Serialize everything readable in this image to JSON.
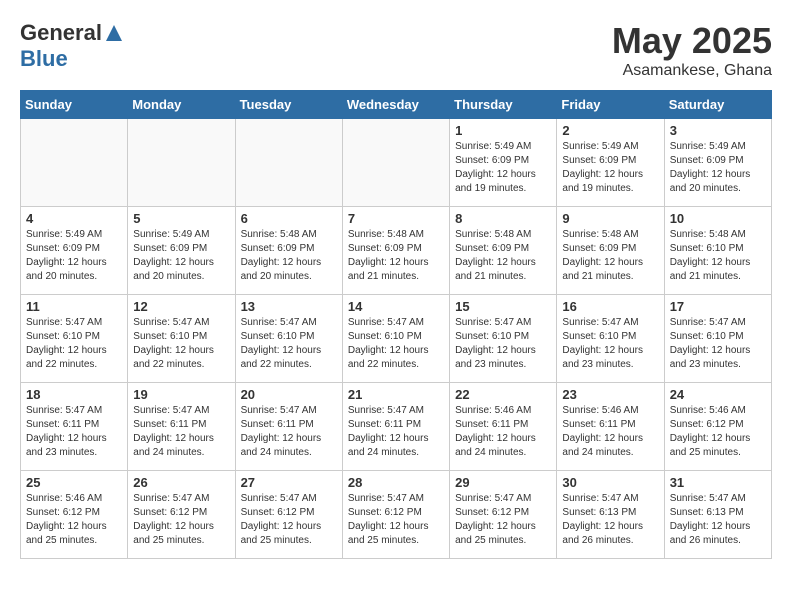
{
  "logo": {
    "general": "General",
    "blue": "Blue"
  },
  "calendar": {
    "title": "May 2025",
    "subtitle": "Asamankese, Ghana"
  },
  "headers": [
    "Sunday",
    "Monday",
    "Tuesday",
    "Wednesday",
    "Thursday",
    "Friday",
    "Saturday"
  ],
  "weeks": [
    [
      {
        "num": "",
        "info": ""
      },
      {
        "num": "",
        "info": ""
      },
      {
        "num": "",
        "info": ""
      },
      {
        "num": "",
        "info": ""
      },
      {
        "num": "1",
        "info": "Sunrise: 5:49 AM\nSunset: 6:09 PM\nDaylight: 12 hours\nand 19 minutes."
      },
      {
        "num": "2",
        "info": "Sunrise: 5:49 AM\nSunset: 6:09 PM\nDaylight: 12 hours\nand 19 minutes."
      },
      {
        "num": "3",
        "info": "Sunrise: 5:49 AM\nSunset: 6:09 PM\nDaylight: 12 hours\nand 20 minutes."
      }
    ],
    [
      {
        "num": "4",
        "info": "Sunrise: 5:49 AM\nSunset: 6:09 PM\nDaylight: 12 hours\nand 20 minutes."
      },
      {
        "num": "5",
        "info": "Sunrise: 5:49 AM\nSunset: 6:09 PM\nDaylight: 12 hours\nand 20 minutes."
      },
      {
        "num": "6",
        "info": "Sunrise: 5:48 AM\nSunset: 6:09 PM\nDaylight: 12 hours\nand 20 minutes."
      },
      {
        "num": "7",
        "info": "Sunrise: 5:48 AM\nSunset: 6:09 PM\nDaylight: 12 hours\nand 21 minutes."
      },
      {
        "num": "8",
        "info": "Sunrise: 5:48 AM\nSunset: 6:09 PM\nDaylight: 12 hours\nand 21 minutes."
      },
      {
        "num": "9",
        "info": "Sunrise: 5:48 AM\nSunset: 6:09 PM\nDaylight: 12 hours\nand 21 minutes."
      },
      {
        "num": "10",
        "info": "Sunrise: 5:48 AM\nSunset: 6:10 PM\nDaylight: 12 hours\nand 21 minutes."
      }
    ],
    [
      {
        "num": "11",
        "info": "Sunrise: 5:47 AM\nSunset: 6:10 PM\nDaylight: 12 hours\nand 22 minutes."
      },
      {
        "num": "12",
        "info": "Sunrise: 5:47 AM\nSunset: 6:10 PM\nDaylight: 12 hours\nand 22 minutes."
      },
      {
        "num": "13",
        "info": "Sunrise: 5:47 AM\nSunset: 6:10 PM\nDaylight: 12 hours\nand 22 minutes."
      },
      {
        "num": "14",
        "info": "Sunrise: 5:47 AM\nSunset: 6:10 PM\nDaylight: 12 hours\nand 22 minutes."
      },
      {
        "num": "15",
        "info": "Sunrise: 5:47 AM\nSunset: 6:10 PM\nDaylight: 12 hours\nand 23 minutes."
      },
      {
        "num": "16",
        "info": "Sunrise: 5:47 AM\nSunset: 6:10 PM\nDaylight: 12 hours\nand 23 minutes."
      },
      {
        "num": "17",
        "info": "Sunrise: 5:47 AM\nSunset: 6:10 PM\nDaylight: 12 hours\nand 23 minutes."
      }
    ],
    [
      {
        "num": "18",
        "info": "Sunrise: 5:47 AM\nSunset: 6:11 PM\nDaylight: 12 hours\nand 23 minutes."
      },
      {
        "num": "19",
        "info": "Sunrise: 5:47 AM\nSunset: 6:11 PM\nDaylight: 12 hours\nand 24 minutes."
      },
      {
        "num": "20",
        "info": "Sunrise: 5:47 AM\nSunset: 6:11 PM\nDaylight: 12 hours\nand 24 minutes."
      },
      {
        "num": "21",
        "info": "Sunrise: 5:47 AM\nSunset: 6:11 PM\nDaylight: 12 hours\nand 24 minutes."
      },
      {
        "num": "22",
        "info": "Sunrise: 5:46 AM\nSunset: 6:11 PM\nDaylight: 12 hours\nand 24 minutes."
      },
      {
        "num": "23",
        "info": "Sunrise: 5:46 AM\nSunset: 6:11 PM\nDaylight: 12 hours\nand 24 minutes."
      },
      {
        "num": "24",
        "info": "Sunrise: 5:46 AM\nSunset: 6:12 PM\nDaylight: 12 hours\nand 25 minutes."
      }
    ],
    [
      {
        "num": "25",
        "info": "Sunrise: 5:46 AM\nSunset: 6:12 PM\nDaylight: 12 hours\nand 25 minutes."
      },
      {
        "num": "26",
        "info": "Sunrise: 5:47 AM\nSunset: 6:12 PM\nDaylight: 12 hours\nand 25 minutes."
      },
      {
        "num": "27",
        "info": "Sunrise: 5:47 AM\nSunset: 6:12 PM\nDaylight: 12 hours\nand 25 minutes."
      },
      {
        "num": "28",
        "info": "Sunrise: 5:47 AM\nSunset: 6:12 PM\nDaylight: 12 hours\nand 25 minutes."
      },
      {
        "num": "29",
        "info": "Sunrise: 5:47 AM\nSunset: 6:12 PM\nDaylight: 12 hours\nand 25 minutes."
      },
      {
        "num": "30",
        "info": "Sunrise: 5:47 AM\nSunset: 6:13 PM\nDaylight: 12 hours\nand 26 minutes."
      },
      {
        "num": "31",
        "info": "Sunrise: 5:47 AM\nSunset: 6:13 PM\nDaylight: 12 hours\nand 26 minutes."
      }
    ]
  ]
}
